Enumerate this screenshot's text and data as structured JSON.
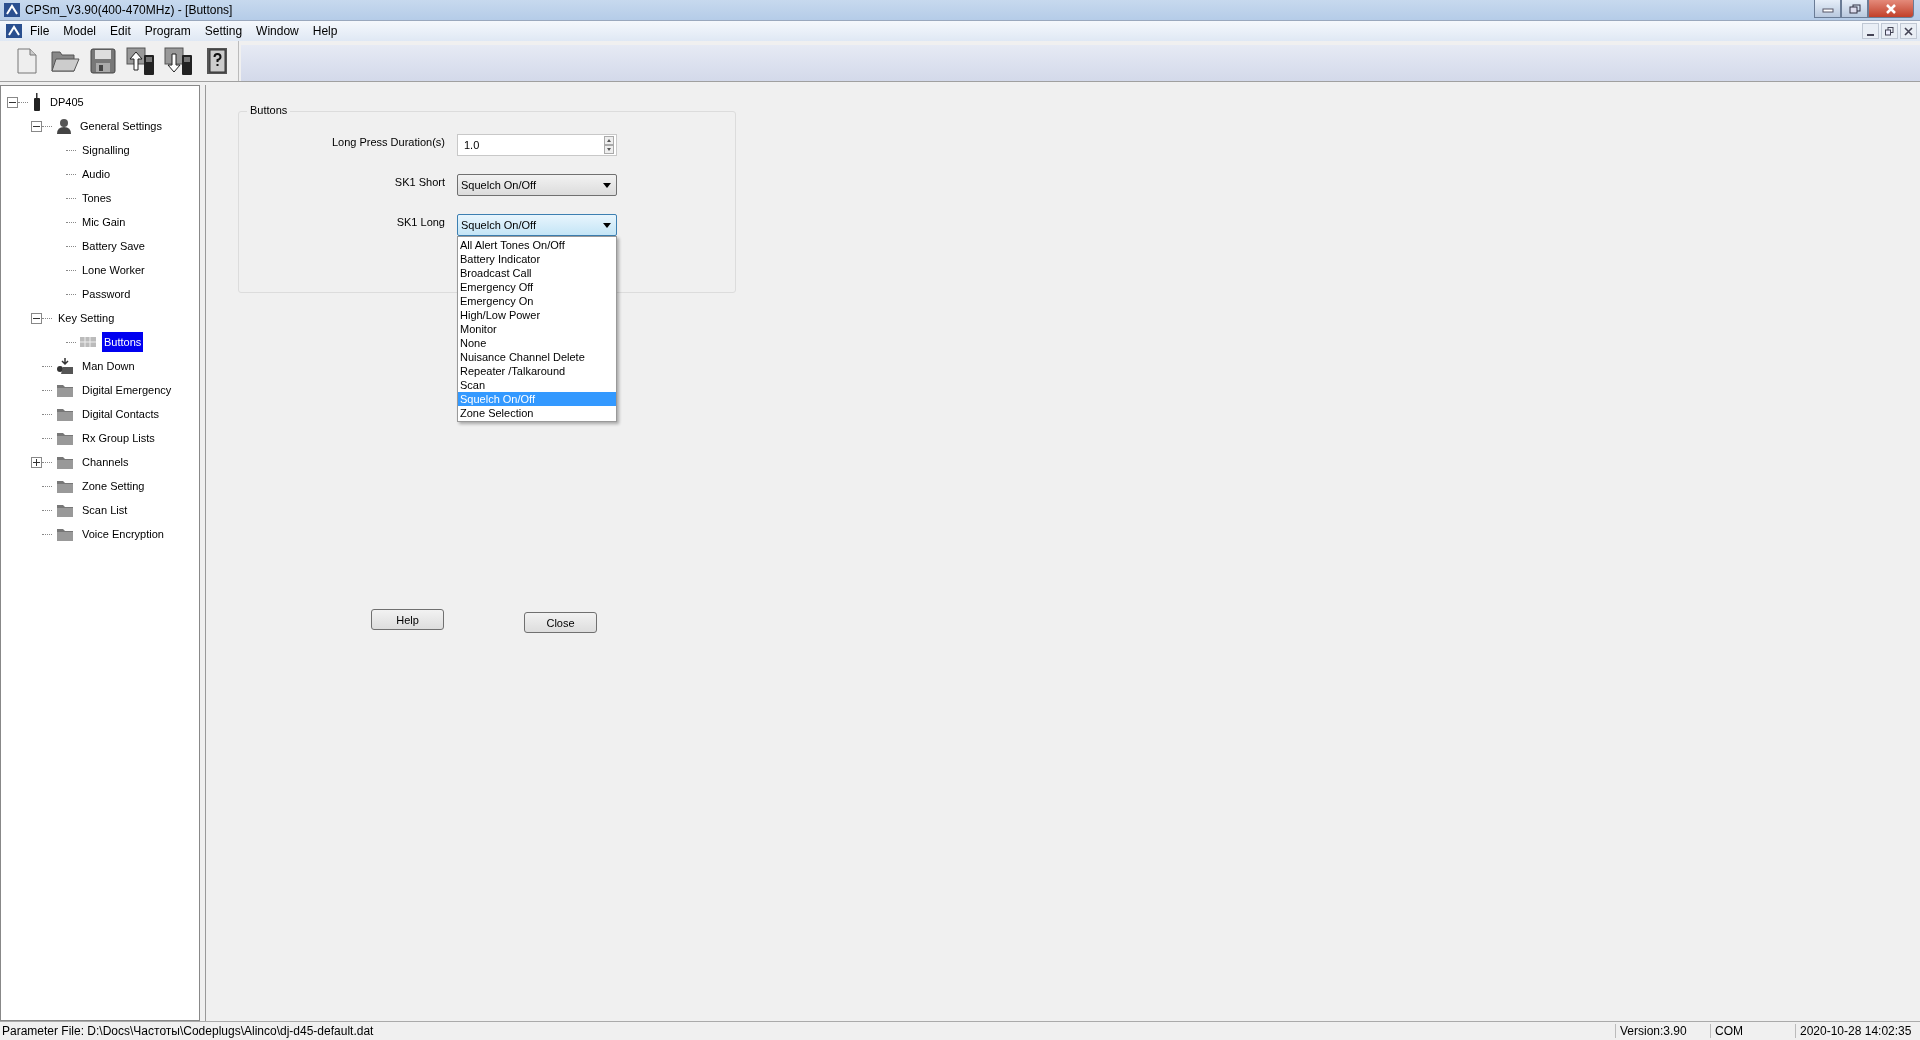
{
  "window": {
    "title": "CPSm_V3.90(400-470MHz) - [Buttons]"
  },
  "menu": [
    "File",
    "Model",
    "Edit",
    "Program",
    "Setting",
    "Window",
    "Help"
  ],
  "tree": [
    {
      "label": "DP405",
      "kind": "device",
      "expanded": true,
      "selected": false,
      "children": [
        {
          "label": "General Settings",
          "kind": "person",
          "expanded": true,
          "selected": false,
          "children": [
            {
              "label": "Signalling",
              "kind": "leaf",
              "selected": false
            },
            {
              "label": "Audio",
              "kind": "leaf",
              "selected": false
            },
            {
              "label": "Tones",
              "kind": "leaf",
              "selected": false
            },
            {
              "label": "Mic Gain",
              "kind": "leaf",
              "selected": false
            },
            {
              "label": "Battery Save",
              "kind": "leaf",
              "selected": false
            },
            {
              "label": "Lone Worker",
              "kind": "leaf",
              "selected": false
            },
            {
              "label": "Password",
              "kind": "leaf",
              "selected": false
            }
          ]
        },
        {
          "label": "Key Setting",
          "kind": "leaf",
          "expanded": true,
          "selected": false,
          "children": [
            {
              "label": "Buttons",
              "kind": "grid",
              "selected": true
            }
          ]
        },
        {
          "label": "Man Down",
          "kind": "mandown",
          "selected": false
        },
        {
          "label": "Digital Emergency",
          "kind": "folder",
          "selected": false
        },
        {
          "label": "Digital Contacts",
          "kind": "folder",
          "selected": false
        },
        {
          "label": "Rx Group Lists",
          "kind": "folder",
          "selected": false
        },
        {
          "label": "Channels",
          "kind": "folder",
          "expanded": false,
          "selected": false
        },
        {
          "label": "Zone Setting",
          "kind": "folder",
          "selected": false
        },
        {
          "label": "Scan List",
          "kind": "folder",
          "selected": false
        },
        {
          "label": "Voice Encryption",
          "kind": "folder",
          "selected": false
        }
      ]
    }
  ],
  "form": {
    "group_title": "Buttons",
    "fields": [
      {
        "label": "Long Press Duration(s)",
        "kind": "spinner",
        "value": "1.0"
      },
      {
        "label": "SK1 Short",
        "kind": "combo",
        "value": "Squelch On/Off",
        "open": false
      },
      {
        "label": "SK1 Long",
        "kind": "combo",
        "value": "Squelch On/Off",
        "open": true,
        "options": [
          {
            "label": "All Alert Tones On/Off",
            "selected": false
          },
          {
            "label": "Battery Indicator",
            "selected": false
          },
          {
            "label": "Broadcast Call",
            "selected": false
          },
          {
            "label": "Emergency Off",
            "selected": false
          },
          {
            "label": "Emergency On",
            "selected": false
          },
          {
            "label": "High/Low Power",
            "selected": false
          },
          {
            "label": "Monitor",
            "selected": false
          },
          {
            "label": "None",
            "selected": false
          },
          {
            "label": "Nuisance Channel Delete",
            "selected": false
          },
          {
            "label": "Repeater /Talkaround",
            "selected": false
          },
          {
            "label": "Scan",
            "selected": false
          },
          {
            "label": "Squelch On/Off",
            "selected": true
          },
          {
            "label": "Zone Selection",
            "selected": false
          }
        ]
      }
    ],
    "buttons": [
      "Help",
      "Close"
    ]
  },
  "status_bar": {
    "file": "Parameter File: D:\\Docs\\Частоты\\Codeplugs\\Alinco\\dj-d45-default.dat",
    "version": "Version:3.90",
    "port": "COM",
    "datetime": "2020-10-28 14:02:35"
  }
}
